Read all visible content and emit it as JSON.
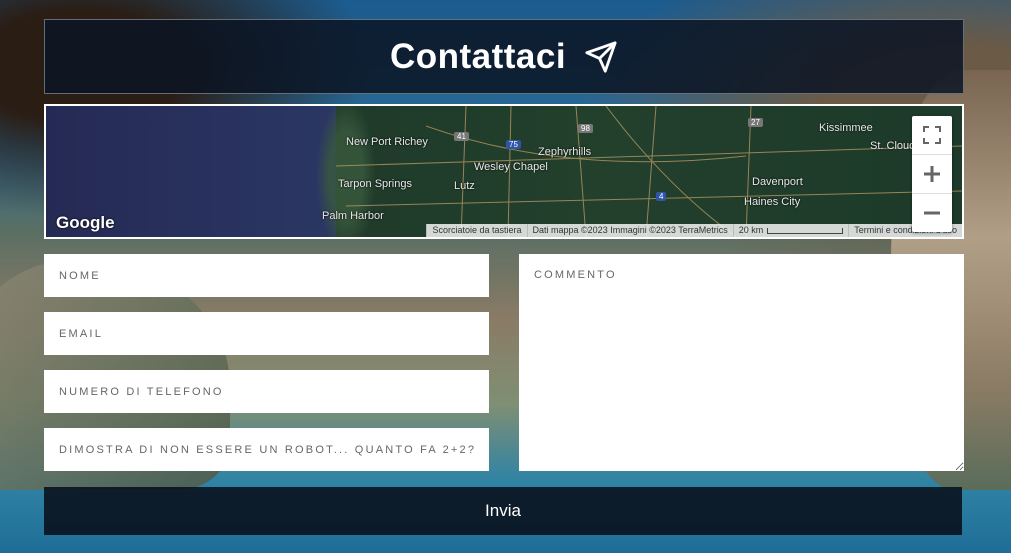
{
  "header": {
    "title": "Contattaci",
    "icon": "paper-plane-icon"
  },
  "map": {
    "places": {
      "new_port_richey": "New Port Richey",
      "tarpon_springs": "Tarpon Springs",
      "palm_harbor": "Palm Harbor",
      "wesley_chapel": "Wesley Chapel",
      "zephyrhills": "Zephyrhills",
      "lutz": "Lutz",
      "kissimmee": "Kissimmee",
      "st_cloud": "St. Cloud",
      "davenport": "Davenport",
      "haines_city": "Haines City"
    },
    "shields": {
      "r41": "41",
      "r75": "75",
      "r98": "98",
      "r27": "27",
      "r4": "4"
    },
    "google_label": "Google",
    "attribution": {
      "shortcuts": "Scorciatoie da tastiera",
      "data": "Dati mappa ©2023 Immagini ©2023 TerraMetrics",
      "scale": "20 km",
      "terms": "Termini e condizioni d'uso"
    }
  },
  "form": {
    "name_placeholder": "NOME",
    "email_placeholder": "EMAIL",
    "phone_placeholder": "NUMERO DI TELEFONO",
    "captcha_placeholder": "DIMOSTRA DI NON ESSERE UN ROBOT... QUANTO FA 2+2?",
    "comment_placeholder": "COMMENTO",
    "submit_label": "Invia"
  }
}
